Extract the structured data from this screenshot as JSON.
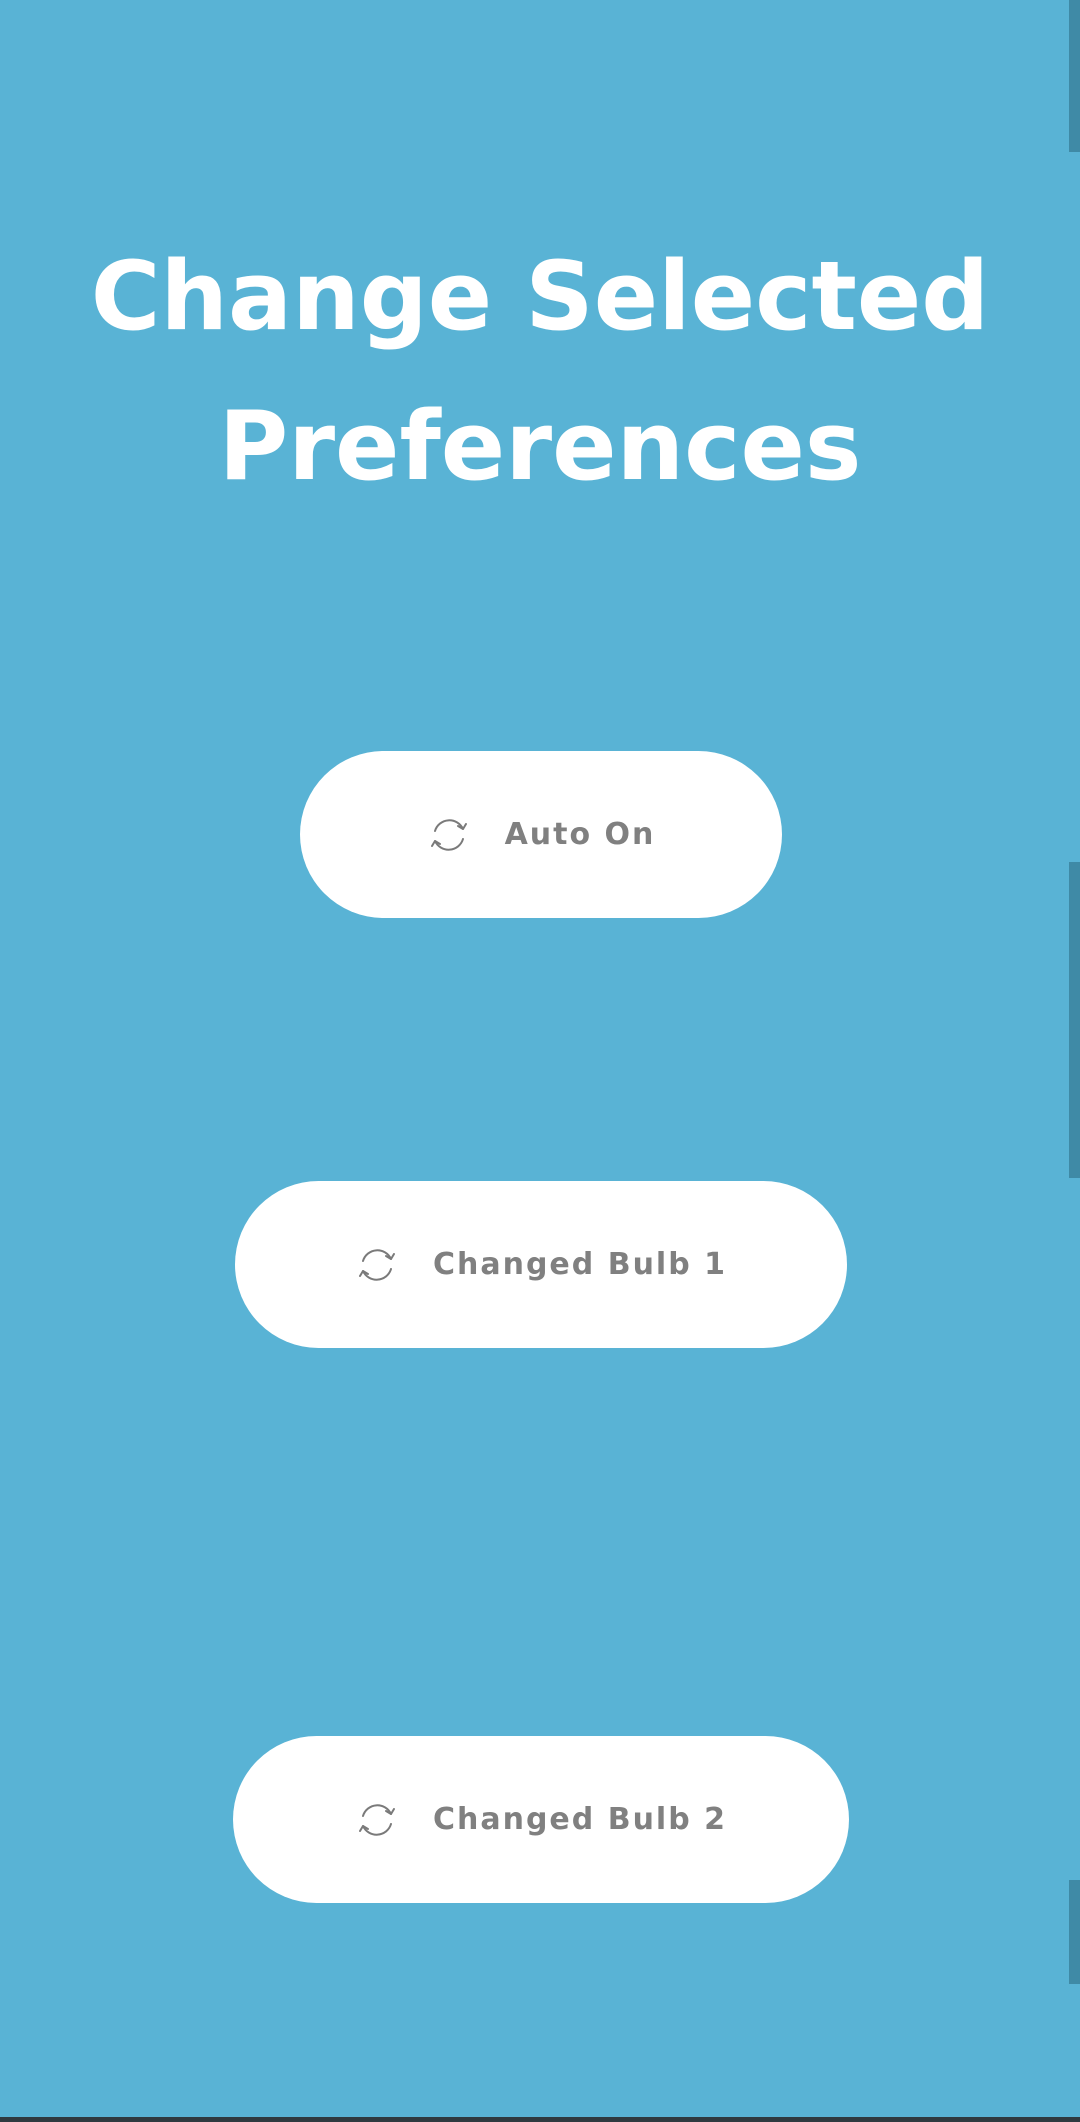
{
  "page": {
    "title_line1": "Change Selected",
    "title_line2": "Preferences",
    "background_color": "#59b3d5"
  },
  "buttons": [
    {
      "label": "Auto On",
      "icon": "refresh-icon"
    },
    {
      "label": "Changed Bulb 1",
      "icon": "refresh-icon"
    },
    {
      "label": "Changed Bulb 2",
      "icon": "refresh-icon"
    }
  ],
  "colors": {
    "button_background": "#ffffff",
    "button_text": "#808080",
    "title_text": "#ffffff"
  }
}
